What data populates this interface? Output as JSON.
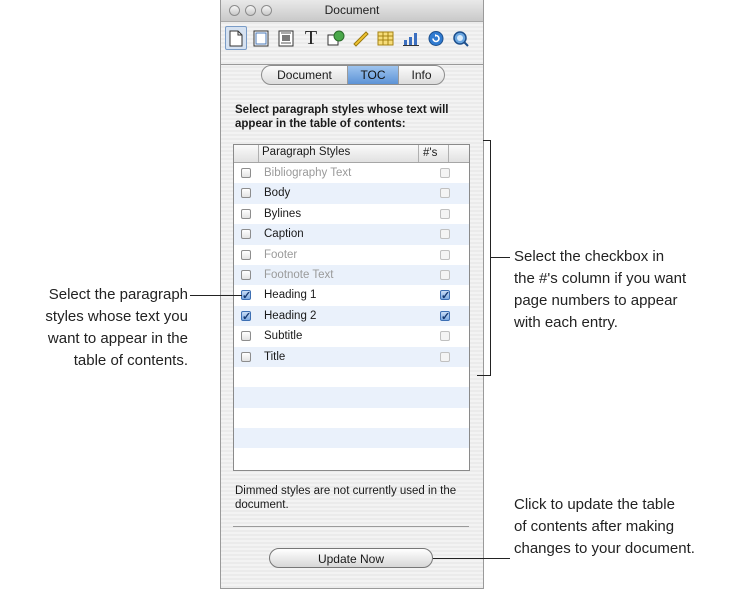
{
  "window": {
    "title": "Document"
  },
  "toolbar": {
    "tools": [
      {
        "icon": "document-icon"
      },
      {
        "icon": "layout-icon"
      },
      {
        "icon": "wrap-icon"
      },
      {
        "icon": "text-icon"
      },
      {
        "icon": "graphic-icon"
      },
      {
        "icon": "metrics-icon"
      },
      {
        "icon": "table-icon"
      },
      {
        "icon": "chart-icon"
      },
      {
        "icon": "hyperlink-icon"
      },
      {
        "icon": "quicktime-icon"
      }
    ]
  },
  "tabs": {
    "document": "Document",
    "toc": "TOC",
    "info": "Info",
    "selected": "TOC"
  },
  "instructions": "Select paragraph styles whose text will appear in the table of contents:",
  "table": {
    "headers": {
      "styles": "Paragraph Styles",
      "numbers": "#'s"
    },
    "rows": [
      {
        "name": "Bibliography Text",
        "checked": false,
        "dimmed": true,
        "page_numbers": false
      },
      {
        "name": "Body",
        "checked": false,
        "dimmed": false,
        "page_numbers": false
      },
      {
        "name": "Bylines",
        "checked": false,
        "dimmed": false,
        "page_numbers": false
      },
      {
        "name": "Caption",
        "checked": false,
        "dimmed": false,
        "page_numbers": false
      },
      {
        "name": "Footer",
        "checked": false,
        "dimmed": true,
        "page_numbers": false
      },
      {
        "name": "Footnote Text",
        "checked": false,
        "dimmed": true,
        "page_numbers": false
      },
      {
        "name": "Heading 1",
        "checked": true,
        "dimmed": false,
        "page_numbers": true
      },
      {
        "name": "Heading 2",
        "checked": true,
        "dimmed": false,
        "page_numbers": true
      },
      {
        "name": "Subtitle",
        "checked": false,
        "dimmed": false,
        "page_numbers": false
      },
      {
        "name": "Title",
        "checked": false,
        "dimmed": false,
        "page_numbers": false
      }
    ]
  },
  "note": "Dimmed styles are not currently used in the document.",
  "update_button": "Update Now",
  "callouts": {
    "left": [
      "Select the paragraph",
      "styles whose text you",
      "want to appear in the",
      "table of contents."
    ],
    "right_top": [
      "Select the checkbox in",
      "the #'s column if you want",
      "page numbers to appear",
      "with each entry."
    ],
    "right_bottom": [
      "Click to update the table",
      "of contents after making",
      "changes to your document."
    ]
  },
  "colors": {
    "selected_tab": "#5d93d6",
    "row_stripe": "#eaf1fb",
    "checkbox_checked": "#3d6fb3"
  }
}
